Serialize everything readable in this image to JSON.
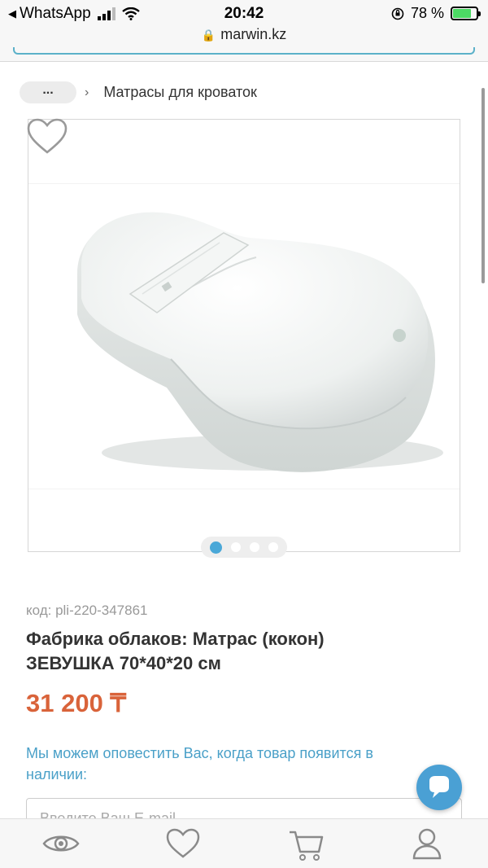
{
  "status_bar": {
    "back_app": "WhatsApp",
    "time": "20:42",
    "battery_percent": "78 %",
    "battery_level": 0.78,
    "icons": [
      "signal-icon",
      "wifi-icon",
      "orientation-lock-icon",
      "battery-charging-icon"
    ]
  },
  "browser": {
    "url": "marwin.kz"
  },
  "breadcrumb": {
    "more_label": "...",
    "separator": "›",
    "current": "Матрасы для кроваток"
  },
  "gallery": {
    "image_alt": "cocoon-mattress-photo",
    "slides_total": 4,
    "active_slide": 1
  },
  "product": {
    "sku": "код: pli-220-347861",
    "title": "Фабрика облаков: Матрас (кокон) ЗЕВУШКА 70*40*20 см",
    "price": "31 200 ₸",
    "notify_text": "Мы можем оповестить Вас, когда товар появится в наличии:",
    "email_placeholder": "Введите Ваш E-mail"
  },
  "bottom_nav": {
    "items": [
      "eye-icon",
      "heart-icon",
      "cart-icon",
      "user-icon"
    ]
  },
  "colors": {
    "accent": "#4aa0d4",
    "price": "#d9633a",
    "notify": "#4aa0c8"
  }
}
